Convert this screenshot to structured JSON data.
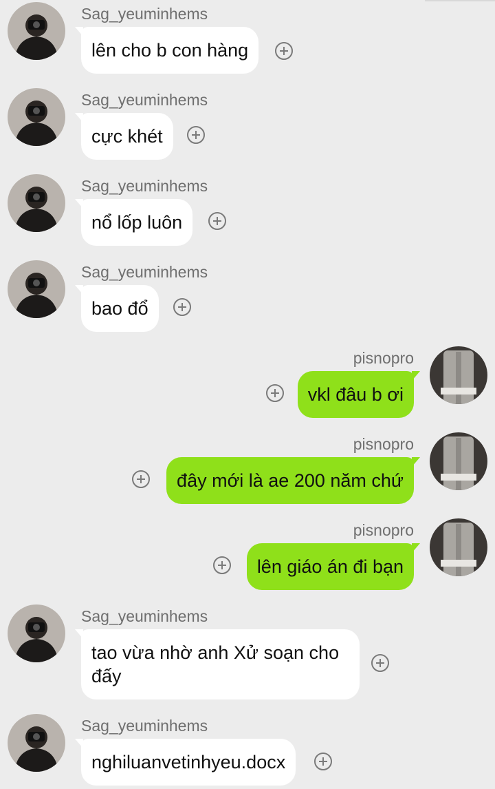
{
  "colors": {
    "background": "#ececec",
    "incoming_bubble": "#ffffff",
    "outgoing_bubble": "#8fe01a",
    "sender_name": "#6f6f6f"
  },
  "icons": {
    "reaction": "add-reaction-icon",
    "avatar_incoming": "person-with-camera-avatar",
    "avatar_outgoing": "grey-jacket-avatar"
  },
  "messages": [
    {
      "direction": "incoming",
      "sender": "Sag_yeuminhems",
      "text": "lên cho b con hàng"
    },
    {
      "direction": "incoming",
      "sender": "Sag_yeuminhems",
      "text": "cực khét"
    },
    {
      "direction": "incoming",
      "sender": "Sag_yeuminhems",
      "text": "nổ lốp luôn"
    },
    {
      "direction": "incoming",
      "sender": "Sag_yeuminhems",
      "text": "bao đổ"
    },
    {
      "direction": "outgoing",
      "sender": "pisnopro",
      "text": "vkl đâu b ơi"
    },
    {
      "direction": "outgoing",
      "sender": "pisnopro",
      "text": "đây mới là ae 200 năm chứ"
    },
    {
      "direction": "outgoing",
      "sender": "pisnopro",
      "text": "lên giáo án đi bạn"
    },
    {
      "direction": "incoming",
      "sender": "Sag_yeuminhems",
      "text": "tao vừa nhờ anh Xử soạn cho\nđấy"
    },
    {
      "direction": "incoming",
      "sender": "Sag_yeuminhems",
      "text": "nghiluanvetinhyeu.docx"
    }
  ]
}
